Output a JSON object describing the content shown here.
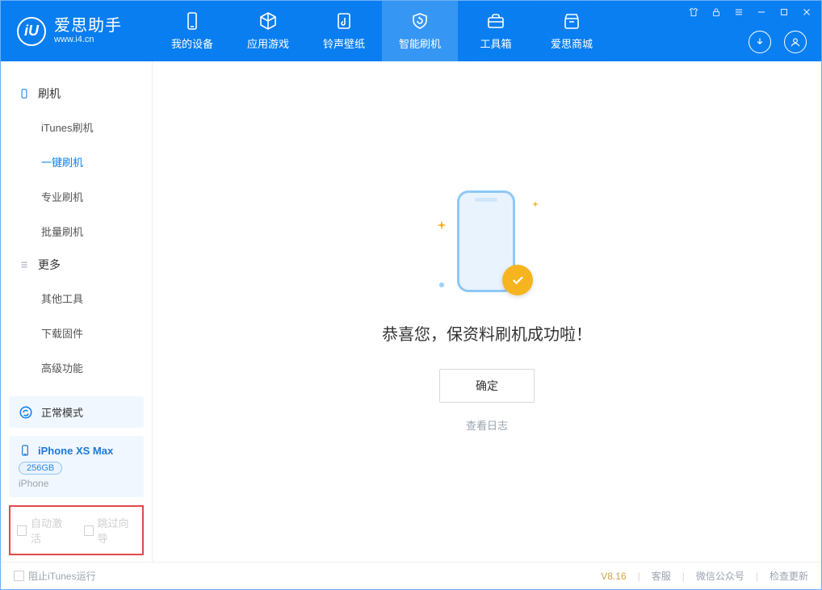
{
  "logo": {
    "icon_letter": "iU",
    "cn": "爱思助手",
    "en": "www.i4.cn"
  },
  "nav": {
    "items": [
      {
        "label": "我的设备"
      },
      {
        "label": "应用游戏"
      },
      {
        "label": "铃声壁纸"
      },
      {
        "label": "智能刷机"
      },
      {
        "label": "工具箱"
      },
      {
        "label": "爱思商城"
      }
    ],
    "active_index": 3
  },
  "sidebar": {
    "section1_title": "刷机",
    "section1_items": [
      {
        "label": "iTunes刷机"
      },
      {
        "label": "一键刷机"
      },
      {
        "label": "专业刷机"
      },
      {
        "label": "批量刷机"
      }
    ],
    "section1_active_index": 1,
    "section2_title": "更多",
    "section2_items": [
      {
        "label": "其他工具"
      },
      {
        "label": "下载固件"
      },
      {
        "label": "高级功能"
      }
    ]
  },
  "device": {
    "mode_label": "正常模式",
    "name": "iPhone XS Max",
    "storage": "256GB",
    "type": "iPhone"
  },
  "options": {
    "auto_activate": "自动激活",
    "skip_guide": "跳过向导"
  },
  "main": {
    "success_text": "恭喜您，保资料刷机成功啦！",
    "ok_label": "确定",
    "view_log": "查看日志"
  },
  "footer": {
    "block_itunes": "阻止iTunes运行",
    "version": "V8.16",
    "support": "客服",
    "wechat": "微信公众号",
    "check_update": "检查更新"
  }
}
